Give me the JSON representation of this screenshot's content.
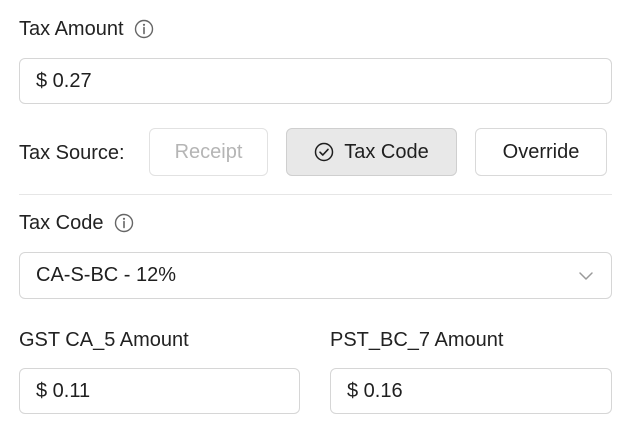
{
  "tax_amount": {
    "label": "Tax Amount",
    "value": "$ 0.27"
  },
  "tax_source": {
    "label": "Tax Source:",
    "options": [
      {
        "label": "Receipt",
        "state": "disabled"
      },
      {
        "label": "Tax Code",
        "state": "selected"
      },
      {
        "label": "Override",
        "state": "default"
      }
    ]
  },
  "tax_code": {
    "label": "Tax Code",
    "selected": "CA-S-BC - 12%"
  },
  "gst": {
    "label": "GST CA_5 Amount",
    "value": "$ 0.11"
  },
  "pst": {
    "label": "PST_BC_7 Amount",
    "value": "$ 0.16"
  },
  "colors": {
    "border": "#d6d6d6",
    "selected_bg": "#e8e8e8",
    "disabled_text": "#b5b5b5"
  },
  "icons": {
    "info": "info-icon",
    "check": "check-circle-icon",
    "chevron": "chevron-down-icon"
  }
}
